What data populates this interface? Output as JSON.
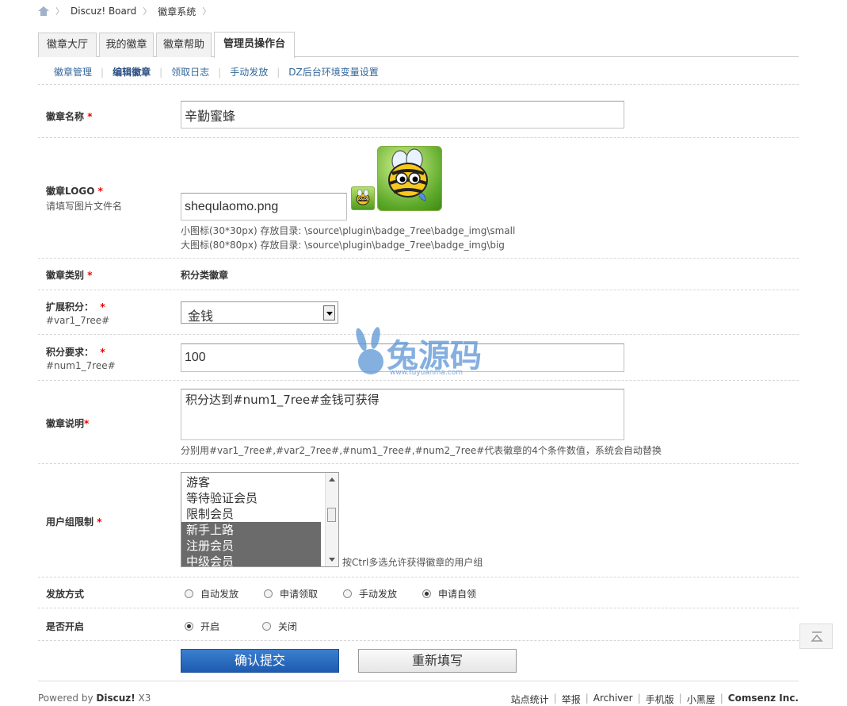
{
  "breadcrumb": {
    "items": [
      "Discuz! Board",
      "徽章系统"
    ]
  },
  "tabs": [
    "徽章大厅",
    "我的徽章",
    "徽章帮助",
    "管理员操作台"
  ],
  "subnav": [
    "徽章管理",
    "编辑徽章",
    "领取日志",
    "手动发放",
    "DZ后台环境变量设置"
  ],
  "form": {
    "name": {
      "label": "徽章名称",
      "required": "*",
      "value": "辛勤蜜蜂"
    },
    "logo": {
      "label": "徽章LOGO",
      "required": "*",
      "sublabel": "请填写图片文件名",
      "value": "shequlaomo.png",
      "note_small": "小图标(30*30px) 存放目录: \\source\\plugin\\badge_7ree\\badge_img\\small",
      "note_big": "大图标(80*80px) 存放目录: \\source\\plugin\\badge_7ree\\badge_img\\big"
    },
    "category": {
      "label": "徽章类别",
      "required": "*",
      "value": "积分类徽章"
    },
    "ext_credit": {
      "label": "扩展积分：",
      "required": "*",
      "sublabel": "#var1_7ree#",
      "value": "金钱"
    },
    "credit_req": {
      "label": "积分要求：",
      "required": "*",
      "sublabel": "#num1_7ree#",
      "value": "100"
    },
    "desc": {
      "label": "徽章说明",
      "required": "*",
      "value": "积分达到#num1_7ree#金钱可获得",
      "note": "分别用#var1_7ree#,#var2_7ree#,#num1_7ree#,#num2_7ree#代表徽章的4个条件数值，系统会自动替换"
    },
    "usergroup": {
      "label": "用户组限制",
      "required": "*",
      "options": [
        "游客",
        "等待验证会员",
        "限制会员",
        "新手上路",
        "注册会员",
        "中级会员"
      ],
      "note": "按Ctrl多选允许获得徽章的用户组"
    },
    "issue": {
      "label": "发放方式",
      "options": [
        "自动发放",
        "申请领取",
        "手动发放",
        "申请自领"
      ],
      "selected": "申请自领"
    },
    "enable": {
      "label": "是否开启",
      "options": [
        "开启",
        "关闭"
      ],
      "selected": "开启"
    },
    "submit": "确认提交",
    "reset": "重新填写"
  },
  "watermark": {
    "text": "兔源码",
    "url": "www.tuyuanma.com"
  },
  "footer": {
    "powered_prefix": "Powered by ",
    "powered_brand": "Discuz!",
    "powered_version": " X3",
    "links": [
      "站点统计",
      "举报",
      "Archiver",
      "手机版",
      "小黑屋"
    ],
    "company": "Comsenz Inc."
  }
}
